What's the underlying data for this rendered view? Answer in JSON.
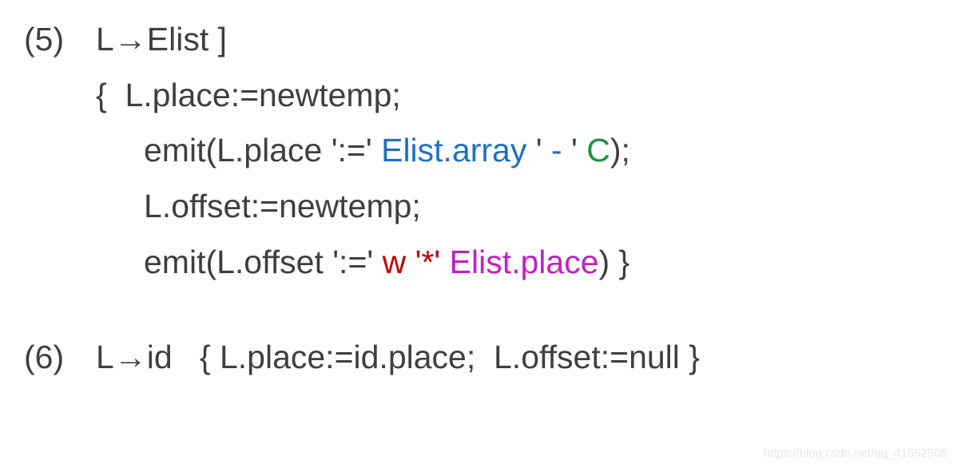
{
  "rule5": {
    "num": "(5)",
    "prod": "L→Elist ]",
    "line1_open": "{  ",
    "line1_body": "L.place:=newtemp;",
    "line2_a": "emit(L.place ':=' ",
    "line2_b": "Elist.array",
    "line2_c": " ' ",
    "line2_d": "- ",
    "line2_e": "' ",
    "line2_f": "C",
    "line2_g": ");",
    "line3": "L.offset:=newtemp;",
    "line4_a": "emit(L.offset ':=' ",
    "line4_b": "w ",
    "line4_c": "'*' ",
    "line4_d": "Elist.place",
    "line4_e": ") }"
  },
  "rule6": {
    "num": "(6)",
    "prod": "L→id   ",
    "action": "{ L.place:=id.place;  L.offset:=null }"
  },
  "watermark": "https://blog.csdn.net/qq_41552508"
}
